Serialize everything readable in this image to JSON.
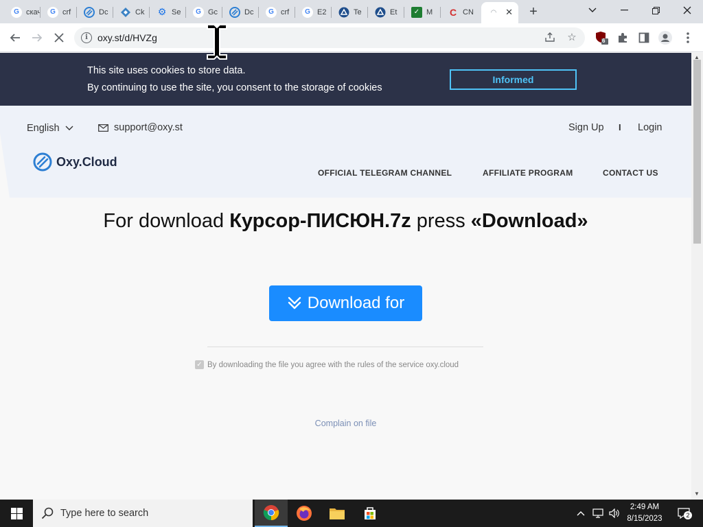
{
  "browser": {
    "tabs": [
      {
        "title": "скачать",
        "favicon": "google-icon"
      },
      {
        "title": "crf",
        "favicon": "google-icon"
      },
      {
        "title": "Dc",
        "favicon": "oxy-cloud-icon"
      },
      {
        "title": "Ck",
        "favicon": "diamond-icon"
      },
      {
        "title": "Se",
        "favicon": "gear-icon"
      },
      {
        "title": "Gc",
        "favicon": "google-icon"
      },
      {
        "title": "Dc",
        "favicon": "oxy-cloud-icon"
      },
      {
        "title": "crf",
        "favicon": "google-icon"
      },
      {
        "title": "E2",
        "favicon": "google-icon"
      },
      {
        "title": "Te",
        "favicon": "triangle-icon"
      },
      {
        "title": "Et",
        "favicon": "triangle-icon"
      },
      {
        "title": "M",
        "favicon": "check-icon"
      },
      {
        "title": "CN",
        "favicon": "c-icon"
      },
      {
        "title": "",
        "favicon": "loading-icon"
      }
    ],
    "new_tab_label": "+",
    "address": "oxy.st/d/HVZg"
  },
  "cookie_banner": {
    "line1": "This site uses cookies to store data.",
    "line2": "By continuing to use the site, you consent to the storage of cookies",
    "button": "Informed"
  },
  "header": {
    "language": "English",
    "email": "support@oxy.st",
    "sign_up": "Sign Up",
    "separator": "I",
    "login": "Login",
    "logo_text": "Oxy.Cloud",
    "nav": [
      "OFFICIAL TELEGRAM CHANNEL",
      "AFFILIATE PROGRAM",
      "CONTACT US"
    ]
  },
  "main": {
    "headline_prefix": "For download ",
    "file_name": "Курсор-ПИСЮН.7z",
    "headline_middle": " press ",
    "headline_action": "«Download»",
    "download_button": "Download for",
    "agreement": "By downloading the file you agree with the rules of the service oxy.cloud",
    "complain": "Complain on file"
  },
  "taskbar": {
    "search_placeholder": "Type here to search",
    "time": "2:49 AM",
    "date": "8/15/2023",
    "notification_count": "2"
  },
  "extensions": {
    "ublock_badge": "6"
  },
  "colors": {
    "cookie_bg": "#2c3248",
    "accent": "#4fc3f7",
    "download_blue": "#1a8cff",
    "header_bg": "#eef2f9"
  }
}
